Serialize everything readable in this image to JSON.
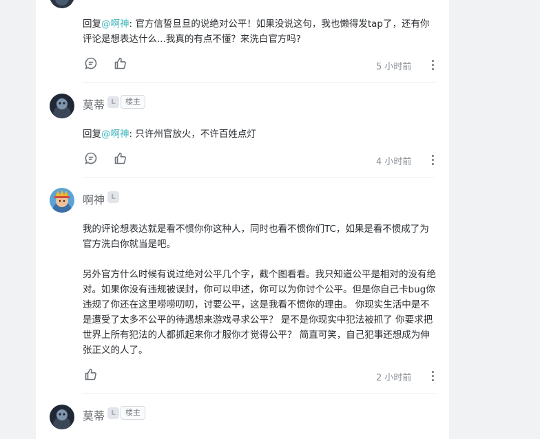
{
  "comments": [
    {
      "reply_prefix": "回复",
      "mention": "@啊神",
      "text": ": 官方信誓旦旦的说绝对公平！如果没说这句，我也懒得发tap了，还有你评论是想表达什么...我真的有点不懂？来洗白官方吗?",
      "time": "5 小时前"
    },
    {
      "author": "莫蒂",
      "level_icon": "level-badge-icon",
      "badge": "楼主",
      "reply_prefix": "回复",
      "mention": "@啊神",
      "text": ": 只许州官放火，不许百姓点灯",
      "time": "4 小时前"
    },
    {
      "author": "啊神",
      "level_icon": "level-badge-icon",
      "paragraph1": "我的评论想表达就是看不惯你你这种人，同时也看不惯你们TC，如果是看不惯成了为官方洗白你就当是吧。",
      "paragraph2": "另外官方什么时候有说过绝对公平几个字，截个图看看。我只知道公平是相对的没有绝对。如果你没有违规被误封，你可以申述，你可以为你讨个公平。但是你自己卡bug你违规了你还在这里唠唠叨叨，讨要公平，这是我看不惯你的理由。 你现实生活中是不是遭受了太多不公平的待遇想来游戏寻求公平？ 是不是你现实中犯法被抓了 你要求把世界上所有犯法的人都抓起来你才服你才觉得公平？ 简直可笑，自己犯事还想成为伸张正义的人了。",
      "time": "2 小时前"
    },
    {
      "author": "莫蒂",
      "level_icon": "level-badge-icon",
      "badge": "楼主"
    }
  ],
  "icons": {
    "reply": "comment-bubble-icon",
    "like": "thumbs-up-icon",
    "more": "more-vertical-icon"
  },
  "colors": {
    "mention": "#3cb4ba",
    "background": "#f1f2f4",
    "panel": "#ffffff"
  }
}
